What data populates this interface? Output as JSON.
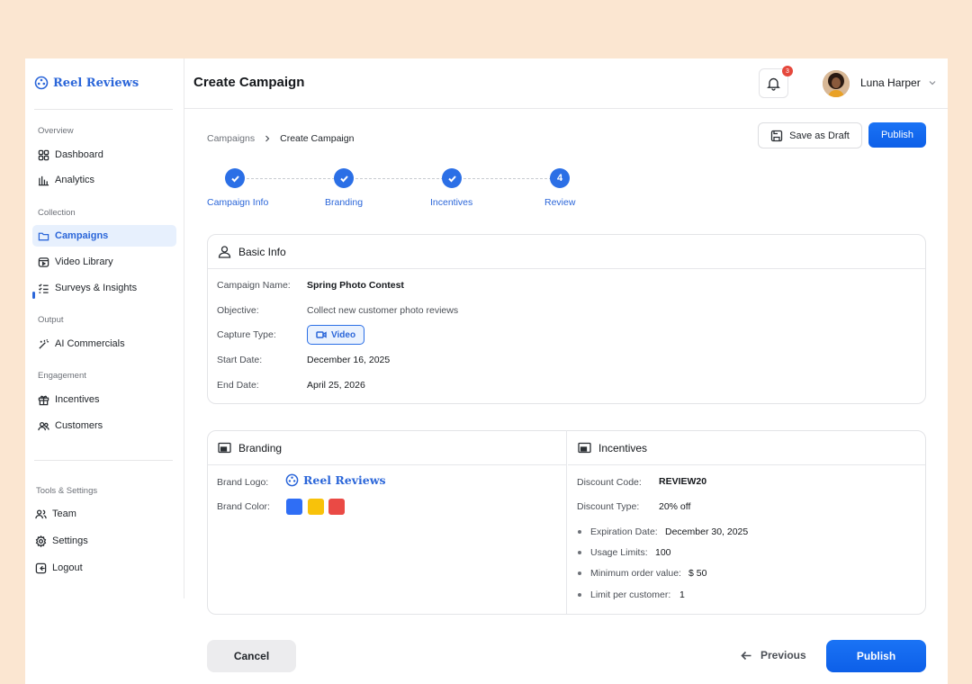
{
  "brand": {
    "name": "Reel Reviews"
  },
  "sidebar": {
    "sections": [
      {
        "label": "Overview"
      },
      {
        "label": "Collection"
      },
      {
        "label": "Output"
      },
      {
        "label": "Engagement"
      },
      {
        "label": "Tools & Settings"
      }
    ],
    "items": [
      {
        "label": "Dashboard",
        "icon": "grid-icon"
      },
      {
        "label": "Analytics",
        "icon": "bar-chart-icon"
      },
      {
        "label": "Campaigns",
        "icon": "folder-icon",
        "active": true
      },
      {
        "label": "Video Library",
        "icon": "video-library-icon"
      },
      {
        "label": "Surveys & Insights",
        "icon": "checklist-icon"
      },
      {
        "label": "AI Commercials",
        "icon": "magic-wand-icon"
      },
      {
        "label": "Incentives",
        "icon": "gift-icon"
      },
      {
        "label": "Customers",
        "icon": "users-icon"
      },
      {
        "label": "Team",
        "icon": "team-icon"
      },
      {
        "label": "Settings",
        "icon": "gear-icon"
      },
      {
        "label": "Logout",
        "icon": "logout-icon"
      }
    ]
  },
  "header": {
    "title": "Create Campaign",
    "notifications_count": "3",
    "user_name": "Luna Harper"
  },
  "breadcrumb": {
    "parent": "Campaigns",
    "current": "Create Campaign"
  },
  "actions": {
    "save_draft": "Save as Draft",
    "publish": "Publish"
  },
  "stepper": {
    "steps": [
      {
        "label": "Campaign Info",
        "state": "done"
      },
      {
        "label": "Branding",
        "state": "done"
      },
      {
        "label": "Incentives",
        "state": "done"
      },
      {
        "label": "Review",
        "state": "current",
        "number": "4"
      }
    ]
  },
  "basic_info": {
    "title": "Basic Info",
    "campaign_name_label": "Campaign Name:",
    "campaign_name": "Spring Photo Contest",
    "objective_label": "Objective:",
    "objective": "Collect new customer photo reviews",
    "capture_type_label": "Capture Type:",
    "capture_type": "Video",
    "start_date_label": "Start Date:",
    "start_date": "December 16, 2025",
    "end_date_label": "End Date:",
    "end_date": "April 25, 2026"
  },
  "branding": {
    "title": "Branding",
    "logo_label": "Brand Logo:",
    "logo_text": "Reel Reviews",
    "color_label": "Brand Color:",
    "colors": [
      "#2f6ef5",
      "#f8c20a",
      "#ea4a45"
    ]
  },
  "incentives": {
    "title": "Incentives",
    "discount_code_label": "Discount Code:",
    "discount_code": "REVIEW20",
    "discount_type_label": "Discount Type:",
    "discount_type": "20% off",
    "expiration_label": "Expiration Date:",
    "expiration": "December 30, 2025",
    "usage_label": "Usage Limits:",
    "usage": "100",
    "min_order_label": "Minimum order value:",
    "min_order": "$ 50",
    "limit_label": "Limit per customer:",
    "limit": "1"
  },
  "footer": {
    "cancel": "Cancel",
    "previous": "Previous",
    "publish": "Publish"
  },
  "colors": {
    "accent": "#2b6fe6",
    "background": "#fbe6d1",
    "badge": "#e5483c"
  }
}
